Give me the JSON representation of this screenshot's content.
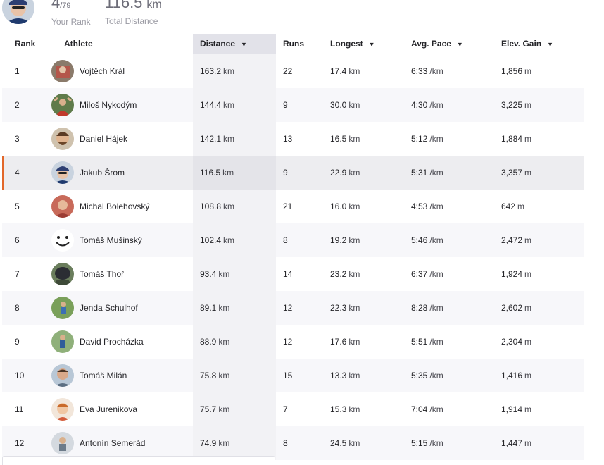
{
  "summary": {
    "rank": "4",
    "rank_total": "/79",
    "rank_label": "Your Rank",
    "distance": "116.5",
    "distance_unit": "km",
    "distance_label": "Total Distance"
  },
  "table": {
    "headers": {
      "rank": "Rank",
      "athlete": "Athlete",
      "distance": "Distance",
      "runs": "Runs",
      "longest": "Longest",
      "pace": "Avg. Pace",
      "elev": "Elev. Gain"
    },
    "rows": [
      {
        "rank": "1",
        "name": "Vojtěch Král",
        "distance": "163.2",
        "runs": "22",
        "longest": "17.4",
        "pace": "6:33",
        "elev": "1,856"
      },
      {
        "rank": "2",
        "name": "Miloš Nykodým",
        "distance": "144.4",
        "runs": "9",
        "longest": "30.0",
        "pace": "4:30",
        "elev": "3,225"
      },
      {
        "rank": "3",
        "name": "Daniel Hájek",
        "distance": "142.1",
        "runs": "13",
        "longest": "16.5",
        "pace": "5:12",
        "elev": "1,884"
      },
      {
        "rank": "4",
        "name": "Jakub Šrom",
        "distance": "116.5",
        "runs": "9",
        "longest": "22.9",
        "pace": "5:31",
        "elev": "3,357"
      },
      {
        "rank": "5",
        "name": "Michal Bolehovský",
        "distance": "108.8",
        "runs": "21",
        "longest": "16.0",
        "pace": "4:53",
        "elev": "642"
      },
      {
        "rank": "6",
        "name": "Tomáš Mušinský",
        "distance": "102.4",
        "runs": "8",
        "longest": "19.2",
        "pace": "5:46",
        "elev": "2,472"
      },
      {
        "rank": "7",
        "name": "Tomáš Thoř",
        "distance": "93.4",
        "runs": "14",
        "longest": "23.2",
        "pace": "6:37",
        "elev": "1,924"
      },
      {
        "rank": "8",
        "name": "Jenda Schulhof",
        "distance": "89.1",
        "runs": "12",
        "longest": "22.3",
        "pace": "8:28",
        "elev": "2,602"
      },
      {
        "rank": "9",
        "name": "David Procházka",
        "distance": "88.9",
        "runs": "12",
        "longest": "17.6",
        "pace": "5:51",
        "elev": "2,304"
      },
      {
        "rank": "10",
        "name": "Tomáš Milán",
        "distance": "75.8",
        "runs": "15",
        "longest": "13.3",
        "pace": "5:35",
        "elev": "1,416"
      },
      {
        "rank": "11",
        "name": "Eva Jurenikova",
        "distance": "75.7",
        "runs": "7",
        "longest": "15.3",
        "pace": "7:04",
        "elev": "1,914"
      },
      {
        "rank": "12",
        "name": "Antonín Semerád",
        "distance": "74.9",
        "runs": "8",
        "longest": "24.5",
        "pace": "5:15",
        "elev": "1,447"
      }
    ],
    "units": {
      "distance": "km",
      "pace": "/km",
      "elev": "m"
    },
    "current_rank": "4"
  },
  "colors": {
    "accent": "#e2672a",
    "sorted_header": "#e2e2e9",
    "row_alt": "#f7f7fa",
    "row_me": "#ededf0"
  }
}
